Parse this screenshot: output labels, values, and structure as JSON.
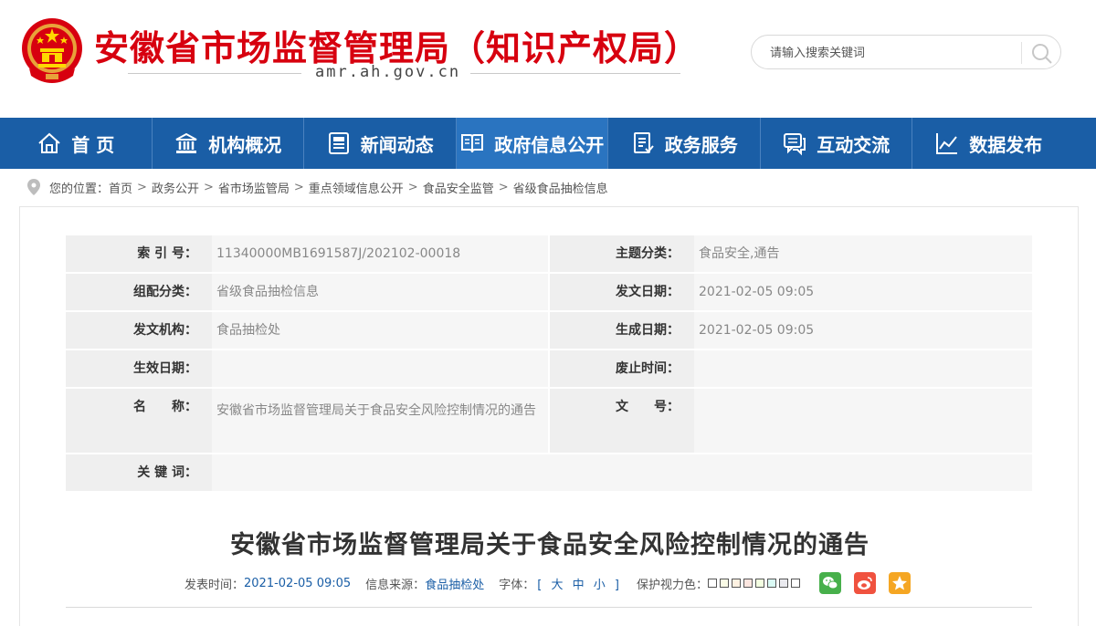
{
  "header": {
    "site_title": "安徽省市场监督管理局（知识产权局）",
    "domain": "amr.ah.gov.cn",
    "search_placeholder": "请输入搜索关键词",
    "brand_color": "#d7000f"
  },
  "nav": {
    "bg_color": "#1a5ea6",
    "items": [
      {
        "label": "首 页",
        "icon": "home-icon"
      },
      {
        "label": "机构概况",
        "icon": "building-icon"
      },
      {
        "label": "新闻动态",
        "icon": "newspaper-icon"
      },
      {
        "label": "政府信息公开",
        "icon": "book-icon",
        "active": true
      },
      {
        "label": "政务服务",
        "icon": "document-icon"
      },
      {
        "label": "互动交流",
        "icon": "chat-icon"
      },
      {
        "label": "数据发布",
        "icon": "chart-icon"
      }
    ]
  },
  "breadcrumb": {
    "prefix": "您的位置：",
    "items": [
      "首页",
      "政务公开",
      "省市场监管局",
      "重点领域信息公开",
      "食品安全监管",
      "省级食品抽检信息"
    ],
    "separator": ">"
  },
  "meta": {
    "index_label": "索 引 号：",
    "index_value": "11340000MB1691587J/202102-00018",
    "topic_label": "主题分类：",
    "topic_value": "食品安全,通告",
    "category_label": "组配分类：",
    "category_value": "省级食品抽检信息",
    "issue_date_label": "发文日期：",
    "issue_date_value": "2021-02-05 09:05",
    "issuer_label": "发文机构：",
    "issuer_value": "食品抽检处",
    "created_label": "生成日期：",
    "created_value": "2021-02-05 09:05",
    "effective_label": "生效日期：",
    "effective_value": "",
    "expiry_label": "废止时间：",
    "expiry_value": "",
    "name_label": "名　　称：",
    "name_value": "安徽省市场监督管理局关于食品安全风险控制情况的通告",
    "docno_label": "文　　号：",
    "docno_value": "",
    "keywords_label": "关 键 词：",
    "keywords_value": ""
  },
  "document": {
    "title": "安徽省市场监督管理局关于食品安全风险控制情况的通告",
    "publish_label": "发表时间：",
    "publish_time": "2021-02-05 09:05",
    "source_label": "信息来源：",
    "source": "食品抽检处",
    "font_label": "字体：",
    "font_open": "[",
    "font_large": "大",
    "font_medium": "中",
    "font_small": "小",
    "font_close": "]",
    "eye_label": "保护视力色：",
    "swatch_colors": [
      "#ffffff",
      "#fafbe6",
      "#fff2e2",
      "#fde6e0",
      "#f3ffe1",
      "#dafaf4",
      "#eaeaef",
      "#ffffff"
    ],
    "share": [
      {
        "icon": "wechat-icon",
        "color": "#47b04b"
      },
      {
        "icon": "weibo-icon",
        "color": "#f0523f"
      },
      {
        "icon": "qzone-icon",
        "color": "#f5a623"
      }
    ]
  }
}
